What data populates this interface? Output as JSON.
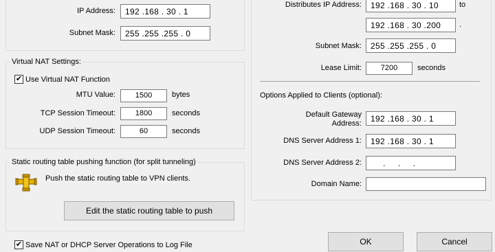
{
  "left": {
    "ip_address": {
      "label": "IP Address:",
      "value": "192 .168 . 30 . 1"
    },
    "subnet_mask": {
      "label": "Subnet Mask:",
      "value": "255 .255 .255 . 0"
    },
    "virtual_nat": {
      "title": "Virtual NAT Settings:",
      "use_checkbox_label": "Use Virtual NAT Function",
      "use_checked": "✔",
      "mtu": {
        "label": "MTU Value:",
        "value": "1500",
        "unit": "bytes"
      },
      "tcp": {
        "label": "TCP Session Timeout:",
        "value": "1800",
        "unit": "seconds"
      },
      "udp": {
        "label": "UDP Session Timeout:",
        "value": "60",
        "unit": "seconds"
      }
    },
    "static_routing": {
      "title": "Static routing table pushing function (for split tunneling)",
      "description": "Push the static routing table to VPN clients.",
      "icon": "pipe-icon",
      "edit_button": "Edit the static routing table to push"
    },
    "log_checkbox_label": "Save NAT or DHCP Server Operations to Log File",
    "log_checked": "✔"
  },
  "right": {
    "distributes": {
      "label": "Distributes IP Address:",
      "start": "192 .168 . 30 . 10",
      "to": "to",
      "end": "192 .168 . 30 .200",
      "end_suffix": "."
    },
    "subnet_mask": {
      "label": "Subnet Mask:",
      "value": "255 .255 .255 . 0"
    },
    "lease": {
      "label": "Lease Limit:",
      "value": "7200",
      "unit": "seconds"
    },
    "options_title": "Options Applied to Clients (optional):",
    "default_gateway": {
      "label_line1": "Default Gateway",
      "label_line2": "Address:",
      "value": "192 .168 . 30 . 1"
    },
    "dns1": {
      "label": "DNS Server Address 1:",
      "value": "192 .168 . 30 . 1"
    },
    "dns2": {
      "label": "DNS Server Address 2:",
      "value": "     .     .     ."
    },
    "domain": {
      "label": "Domain Name:",
      "value": ""
    }
  },
  "buttons": {
    "ok": "OK",
    "cancel": "Cancel"
  }
}
